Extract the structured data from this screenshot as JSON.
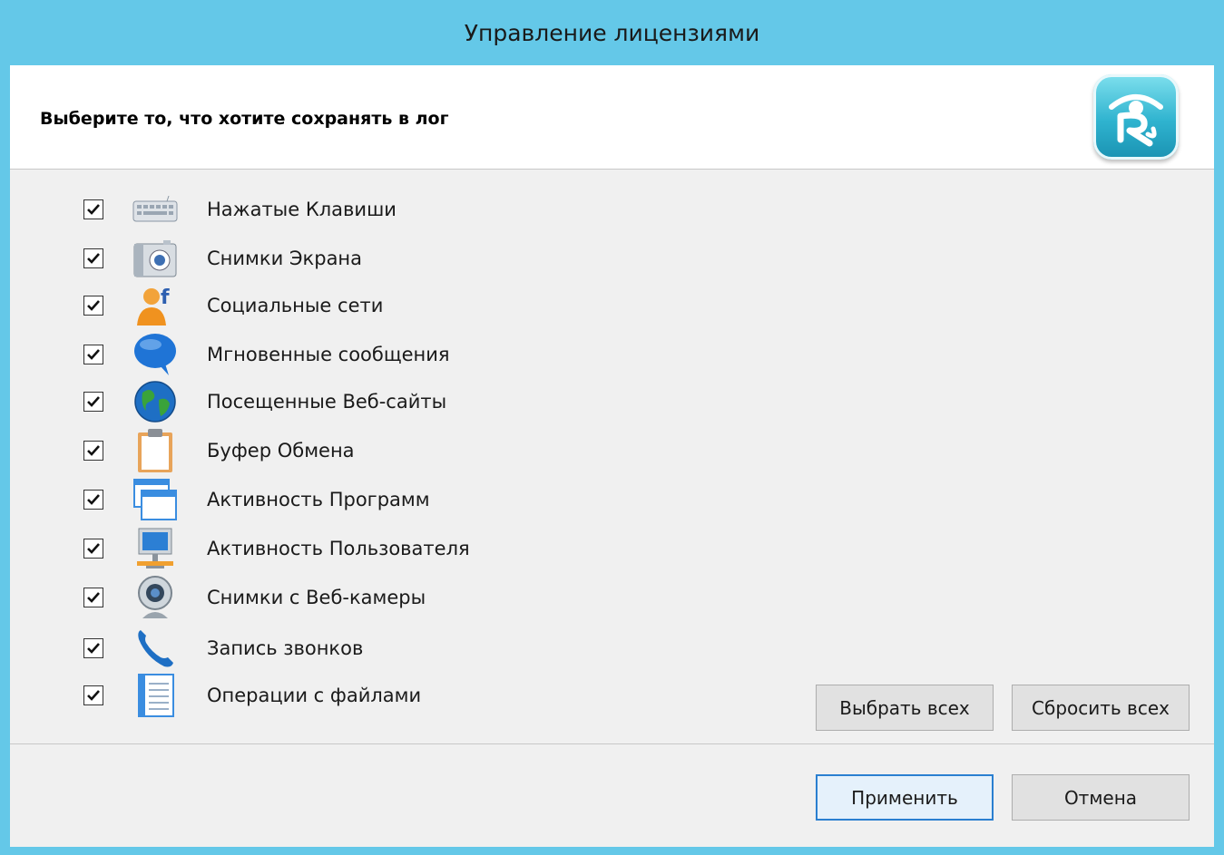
{
  "window": {
    "title": "Управление лицензиями"
  },
  "header": {
    "prompt": "Выберите то, что хотите сохранять в лог"
  },
  "options": [
    {
      "label": "Нажатые Клавиши",
      "checked": true,
      "icon": "keyboard-icon"
    },
    {
      "label": "Снимки Экрана",
      "checked": true,
      "icon": "camera-icon"
    },
    {
      "label": "Социальные сети",
      "checked": true,
      "icon": "social-network-icon"
    },
    {
      "label": "Мгновенные сообщения",
      "checked": true,
      "icon": "chat-bubble-icon"
    },
    {
      "label": "Посещенные Веб-сайты",
      "checked": true,
      "icon": "globe-icon"
    },
    {
      "label": "Буфер Обмена",
      "checked": true,
      "icon": "clipboard-icon"
    },
    {
      "label": "Активность Программ",
      "checked": true,
      "icon": "app-windows-icon"
    },
    {
      "label": "Активность Пользователя",
      "checked": true,
      "icon": "computer-icon"
    },
    {
      "label": "Снимки с Веб-камеры",
      "checked": true,
      "icon": "webcam-icon"
    },
    {
      "label": "Запись звонков",
      "checked": true,
      "icon": "phone-icon"
    },
    {
      "label": "Операции с файлами",
      "checked": true,
      "icon": "notebook-icon"
    }
  ],
  "buttons": {
    "select_all": "Выбрать всех",
    "reset_all": "Сбросить всех",
    "apply": "Применить",
    "cancel": "Отмена"
  },
  "colors": {
    "titlebar": "#64c8e8",
    "accent": "#2a7fd0"
  }
}
